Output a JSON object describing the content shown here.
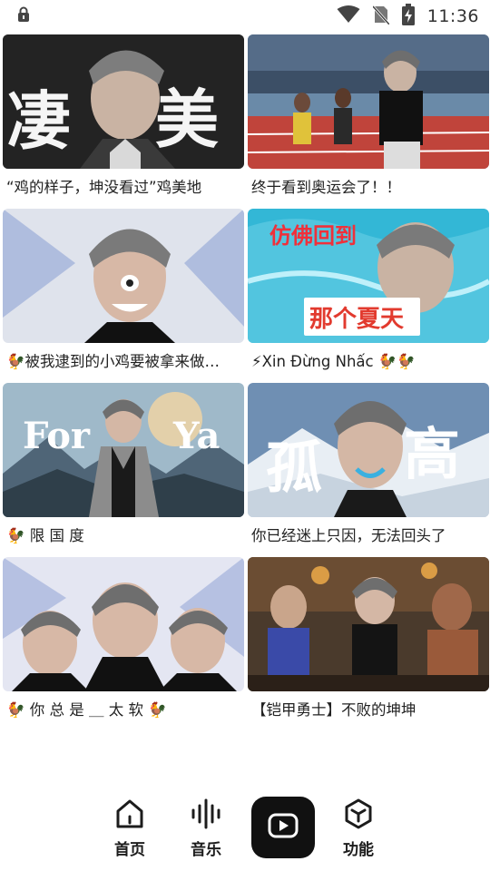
{
  "status_bar": {
    "time": "11:36",
    "icons": [
      "lock-icon",
      "wifi-icon",
      "no-sim-icon",
      "battery-charging-icon"
    ]
  },
  "feed": {
    "videos": [
      {
        "title": "“鸡的样子，坤没看过”鸡美地",
        "thumb_text": "凄 美"
      },
      {
        "title": "终于看到奥运会了！！",
        "thumb_text": ""
      },
      {
        "title": "🐓被我逮到的小鸡要被拿来做…",
        "thumb_text": ""
      },
      {
        "title": "⚡Xin Đừng Nhấc 🐓🐓",
        "thumb_text": "仿佛回到 那个夏天"
      },
      {
        "title": "🐓 限 国 度",
        "thumb_text": "For Ya"
      },
      {
        "title": "你已经迷上只因，无法回头了",
        "thumb_text": "孤 高"
      },
      {
        "title": "🐓 你 总 是 ＿ 太 软 🐓",
        "thumb_text": ""
      },
      {
        "title": "【铠甲勇士】不败的坤坤",
        "thumb_text": ""
      }
    ]
  },
  "bottom_nav": {
    "home_label": "首页",
    "music_label": "音乐",
    "video_label": "",
    "functions_label": "功能"
  },
  "colors": {
    "nav_center_bg": "#111111",
    "text_primary": "#222222"
  }
}
